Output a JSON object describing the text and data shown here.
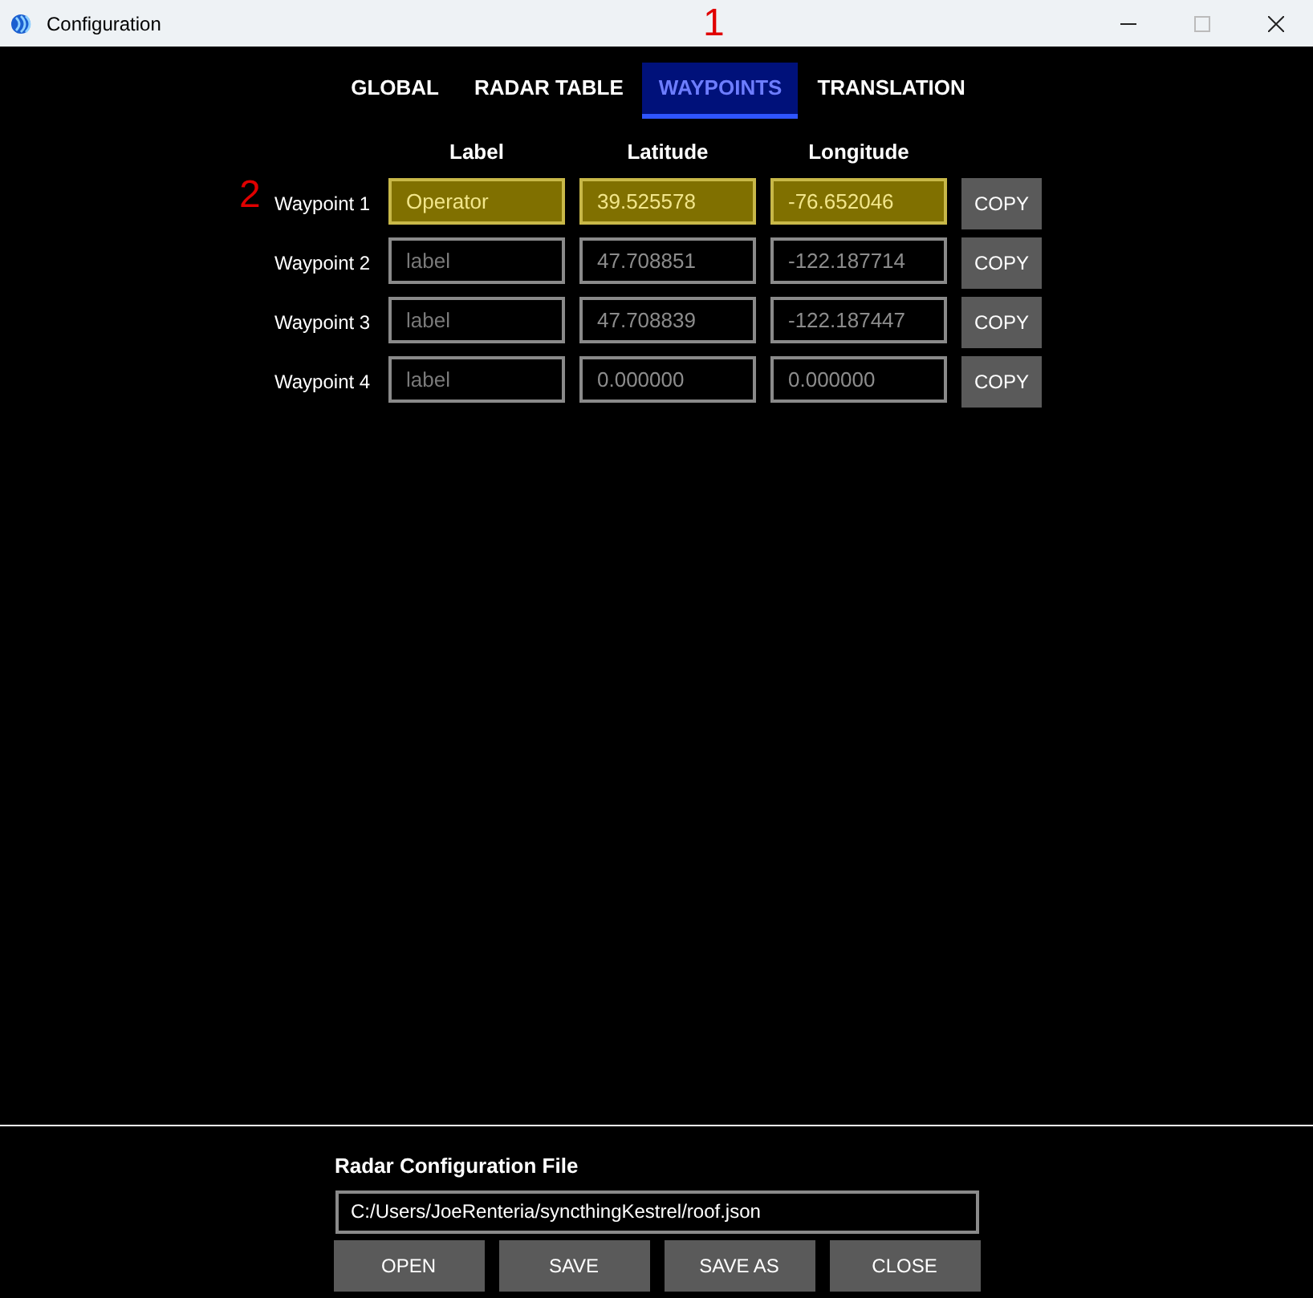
{
  "window": {
    "title": "Configuration"
  },
  "annotations": [
    "1",
    "2"
  ],
  "tabs": [
    {
      "label": "GLOBAL",
      "selected": false
    },
    {
      "label": "RADAR TABLE",
      "selected": false
    },
    {
      "label": "WAYPOINTS",
      "selected": true
    },
    {
      "label": "TRANSLATION",
      "selected": false
    }
  ],
  "table": {
    "columns": [
      "Label",
      "Latitude",
      "Longitude"
    ],
    "rows": [
      {
        "name": "Waypoint 1",
        "highlighted": true,
        "label": {
          "value": "Operator"
        },
        "latitude": "39.525578",
        "longitude": "-76.652046",
        "button": "COPY"
      },
      {
        "name": "Waypoint 2",
        "highlighted": false,
        "label": {
          "placeholder": "label"
        },
        "latitude": "47.708851",
        "longitude": "-122.187714",
        "button": "COPY"
      },
      {
        "name": "Waypoint 3",
        "highlighted": false,
        "label": {
          "placeholder": "label"
        },
        "latitude": "47.708839",
        "longitude": "-122.187447",
        "button": "COPY"
      },
      {
        "name": "Waypoint 4",
        "highlighted": false,
        "label": {
          "placeholder": "label"
        },
        "latitude": "0.000000",
        "longitude": "0.000000",
        "button": "COPY"
      }
    ]
  },
  "file": {
    "heading": "Radar Configuration File",
    "path": "C:/Users/JoeRenteria/syncthingKestrel/roof.json",
    "buttons": [
      "OPEN",
      "SAVE",
      "SAVE AS",
      "CLOSE"
    ]
  }
}
